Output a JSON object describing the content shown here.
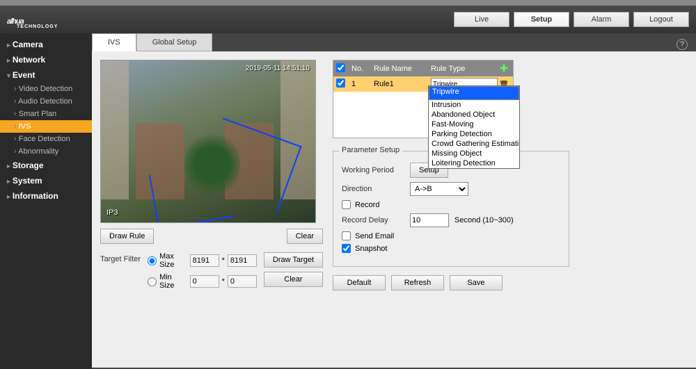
{
  "header": {
    "logo": "alhua",
    "logo_sub": "TECHNOLOGY",
    "buttons": {
      "live": "Live",
      "setup": "Setup",
      "alarm": "Alarm",
      "logout": "Logout"
    }
  },
  "sidebar": {
    "camera": "Camera",
    "network": "Network",
    "event": "Event",
    "event_items": {
      "video_detection": "Video Detection",
      "audio_detection": "Audio Detection",
      "smart_plan": "Smart Plan",
      "ivs": "IVS",
      "face_detection": "Face Detection",
      "abnormality": "Abnormality"
    },
    "storage": "Storage",
    "system": "System",
    "information": "Information"
  },
  "tabs": {
    "ivs": "IVS",
    "global": "Global Setup"
  },
  "preview": {
    "timestamp": "2019-05-11 14:51:10",
    "label": "IP3"
  },
  "buttons": {
    "draw_rule": "Draw Rule",
    "clear": "Clear",
    "draw_target": "Draw Target",
    "default": "Default",
    "refresh": "Refresh",
    "save": "Save"
  },
  "filter": {
    "label": "Target Filter",
    "max": "Max Size",
    "min": "Min Size",
    "max_w": "8191",
    "max_h": "8191",
    "min_w": "0",
    "min_h": "0",
    "star": "*"
  },
  "rules": {
    "header": {
      "no": "No.",
      "name": "Rule Name",
      "type": "Rule Type"
    },
    "row": {
      "no": "1",
      "name": "Rule1",
      "type_selected": "Tripwire"
    },
    "type_options": [
      "Tripwire",
      "Intrusion",
      "Abandoned Object",
      "Fast-Moving",
      "Parking Detection",
      "Crowd Gathering Estimation",
      "Missing Object",
      "Loitering Detection"
    ]
  },
  "params": {
    "legend": "Parameter Setup",
    "working_period": "Working Period",
    "setup": "Setup",
    "direction": "Direction",
    "direction_value": "A->B",
    "record": "Record",
    "record_delay": "Record Delay",
    "record_delay_value": "10",
    "record_delay_hint": "Second (10~300)",
    "send_email": "Send Email",
    "snapshot": "Snapshot"
  }
}
